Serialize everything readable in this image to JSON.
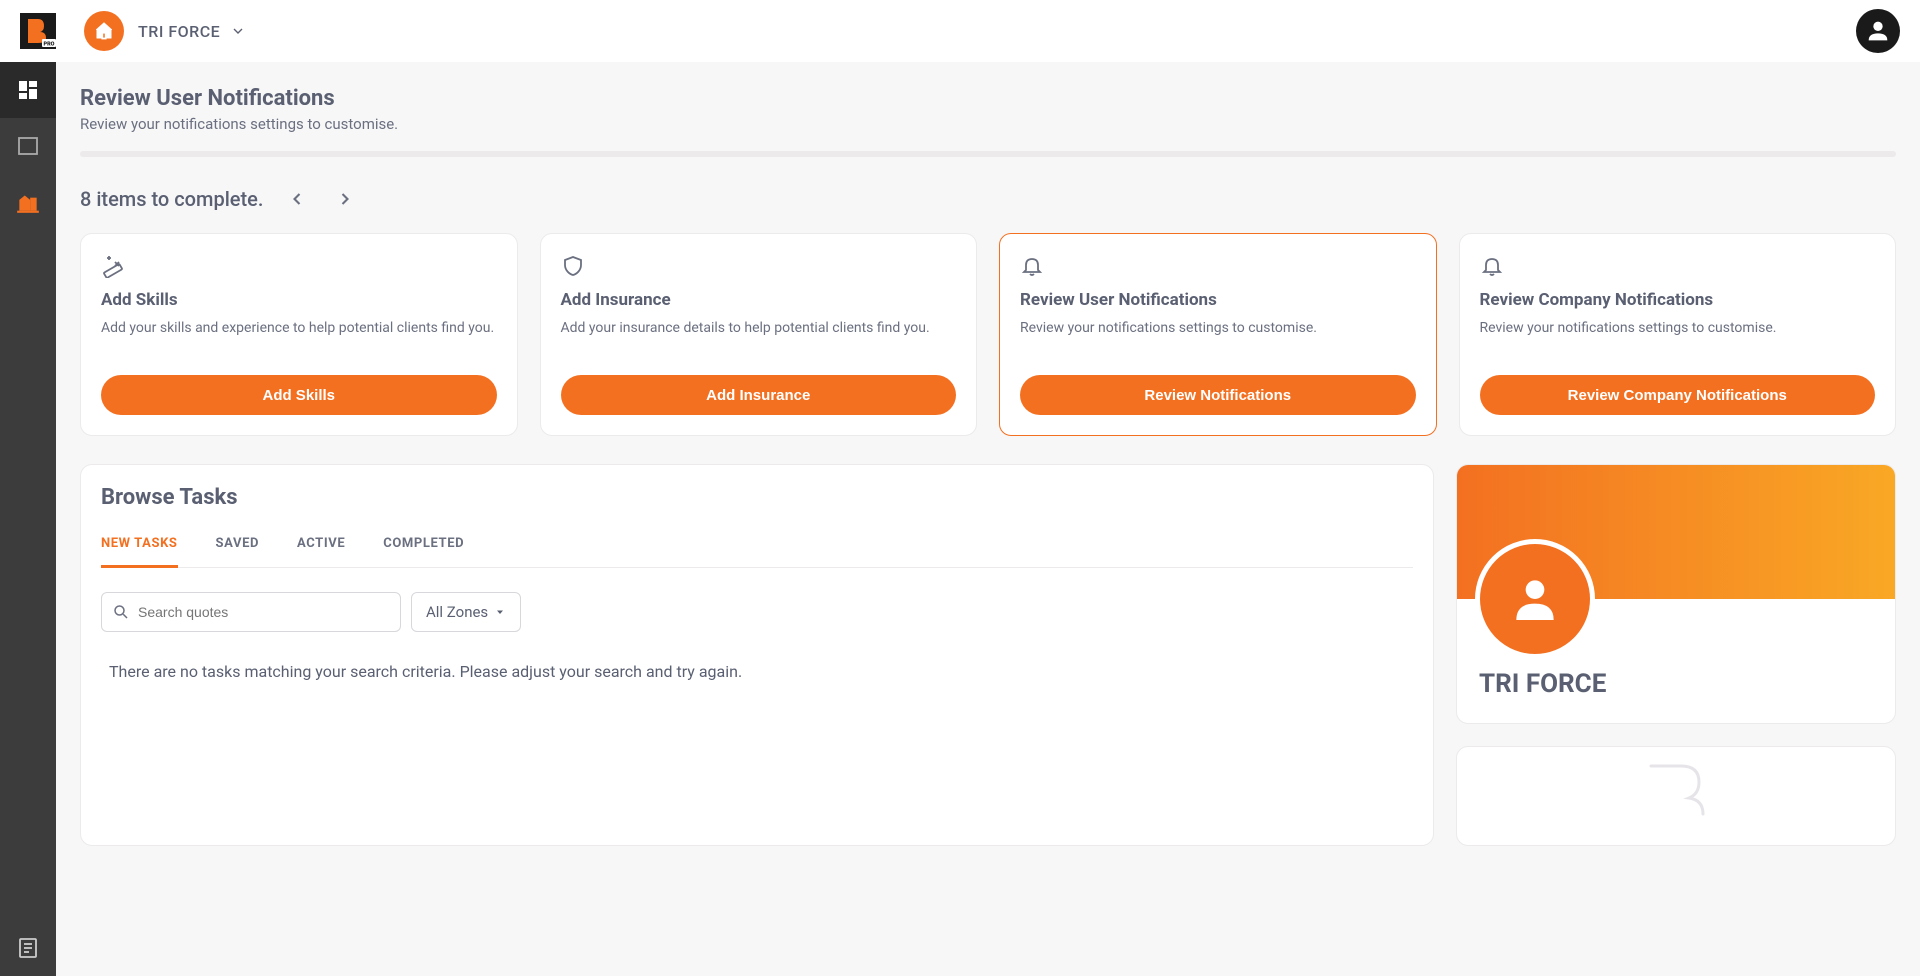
{
  "header": {
    "company_name": "TRI FORCE"
  },
  "page": {
    "title": "Review User Notifications",
    "subtitle": "Review your notifications settings to customise.",
    "items_count": "8 items to complete."
  },
  "cards": [
    {
      "title": "Add Skills",
      "desc": "Add your skills and experience to help potential clients find you.",
      "button": "Add Skills",
      "icon": "ruler"
    },
    {
      "title": "Add Insurance",
      "desc": "Add your insurance details to help potential clients find you.",
      "button": "Add Insurance",
      "icon": "shield"
    },
    {
      "title": "Review User Notifications",
      "desc": "Review your notifications settings to customise.",
      "button": "Review Notifications",
      "icon": "bell"
    },
    {
      "title": "Review Company Notifications",
      "desc": "Review your notifications settings to customise.",
      "button": "Review Company Notifications",
      "icon": "bell"
    }
  ],
  "browse": {
    "title": "Browse Tasks",
    "tabs": [
      "NEW TASKS",
      "SAVED",
      "ACTIVE",
      "COMPLETED"
    ],
    "search_placeholder": "Search quotes",
    "zone_label": "All Zones",
    "empty": "There are no tasks matching your search criteria. Please adjust your search and try again."
  },
  "profile": {
    "name": "TRI FORCE"
  }
}
